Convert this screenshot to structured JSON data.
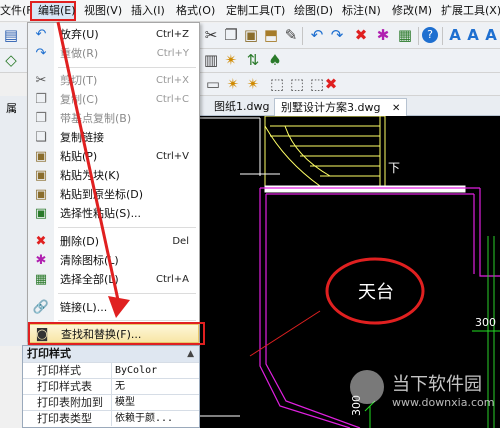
{
  "menubar": {
    "items": [
      {
        "label": "文件(F)"
      },
      {
        "label": "编辑(E)"
      },
      {
        "label": "视图(V)"
      },
      {
        "label": "插入(I)"
      },
      {
        "label": "格式(O)"
      },
      {
        "label": "定制工具(T)"
      },
      {
        "label": "绘图(D)"
      },
      {
        "label": "标注(N)"
      },
      {
        "label": "修改(M)"
      },
      {
        "label": "扩展工具(X)"
      }
    ]
  },
  "tabs": [
    {
      "label": "图纸1.dwg"
    },
    {
      "label": "别墅设计方案3.dwg"
    }
  ],
  "tab_close": "✕",
  "edit_menu": {
    "items": [
      {
        "icon": "undo-icon",
        "label": "放弃(U)",
        "shortcut": "Ctrl+Z",
        "disabled": false
      },
      {
        "icon": "redo-icon",
        "label": "重做(R)",
        "shortcut": "Ctrl+Y",
        "disabled": true
      },
      {
        "icon": "cut-icon",
        "label": "剪切(T)",
        "shortcut": "Ctrl+X",
        "disabled": true
      },
      {
        "icon": "copy-icon",
        "label": "复制(C)",
        "shortcut": "Ctrl+C",
        "disabled": true
      },
      {
        "icon": "copy-base-icon",
        "label": "带基点复制(B)",
        "shortcut": "",
        "disabled": true
      },
      {
        "icon": "copy-link-icon",
        "label": "复制链接",
        "shortcut": "",
        "disabled": false
      },
      {
        "icon": "paste-icon",
        "label": "粘贴(P)",
        "shortcut": "Ctrl+V",
        "disabled": false
      },
      {
        "icon": "paste-block-icon",
        "label": "粘贴为块(K)",
        "shortcut": "",
        "disabled": false
      },
      {
        "icon": "paste-orig-icon",
        "label": "粘贴到原坐标(D)",
        "shortcut": "",
        "disabled": false
      },
      {
        "icon": "paste-special-icon",
        "label": "选择性粘贴(S)...",
        "shortcut": "",
        "disabled": false
      },
      {
        "icon": "delete-icon",
        "label": "删除(D)",
        "shortcut": "Del",
        "disabled": false
      },
      {
        "icon": "clear-icon",
        "label": "清除图标(L)",
        "shortcut": "",
        "disabled": false
      },
      {
        "icon": "select-all-icon",
        "label": "选择全部(L)",
        "shortcut": "Ctrl+A",
        "disabled": false
      },
      {
        "icon": "link-icon",
        "label": "链接(L)...",
        "shortcut": "",
        "disabled": false
      },
      {
        "icon": "binoculars-icon",
        "label": "查找和替换(F)...",
        "shortcut": "",
        "disabled": false
      }
    ]
  },
  "properties": {
    "title": "打印样式",
    "rows": [
      {
        "key": "打印样式",
        "value": "ByColor"
      },
      {
        "key": "打印样式表",
        "value": "无"
      },
      {
        "key": "打印表附加到",
        "value": "模型"
      },
      {
        "key": "打印表类型",
        "value": "依赖于颜..."
      }
    ]
  },
  "drawing": {
    "room_label": "天台",
    "dim_label_1": "300",
    "dim_label_2": "300",
    "dim_label_3": "300",
    "mark_text": "下"
  },
  "left_panel": {
    "label": "属"
  },
  "watermark": {
    "title": "当下软件园",
    "url": "www.downxia.com"
  },
  "colors": {
    "highlight_red": "#e02020",
    "accent_blue": "#1e6fd0"
  }
}
